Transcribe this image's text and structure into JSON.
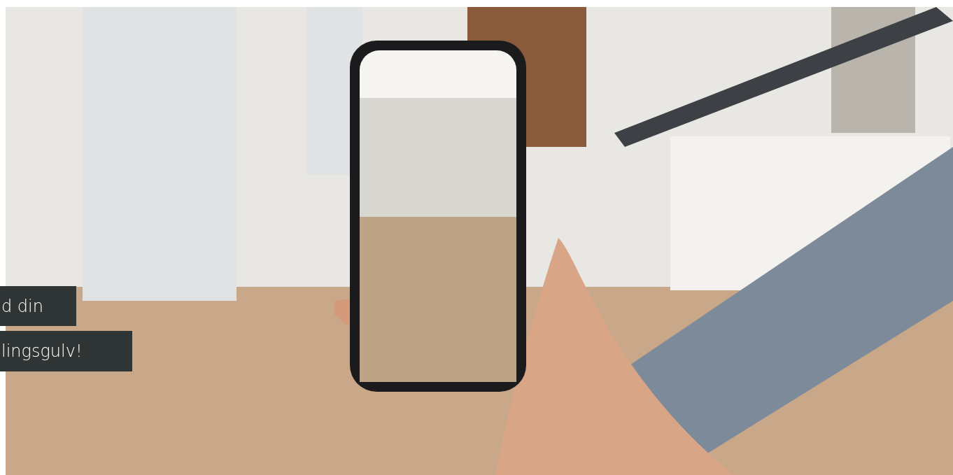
{
  "hero": {
    "caption_lines": [
      "d din",
      "lingsgulv!"
    ]
  }
}
